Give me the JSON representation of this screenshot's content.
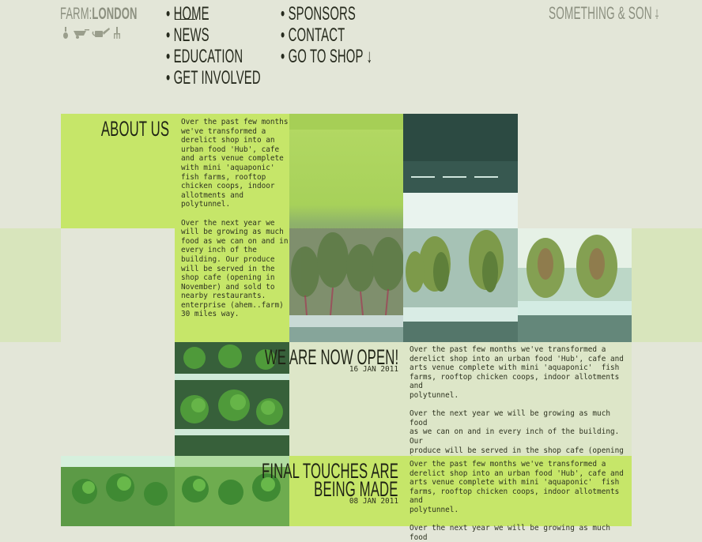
{
  "header": {
    "logo_left": "FARM",
    "logo_sep": ":",
    "logo_right": "LONDON",
    "brand": "SOMETHING & SON",
    "nav": [
      {
        "label": "HOME"
      },
      {
        "label": "NEWS"
      },
      {
        "label": "EDUCATION"
      },
      {
        "label": "GET INVOLVED"
      },
      {
        "label": "SPONSORS"
      },
      {
        "label": "CONTACT"
      },
      {
        "label": "GO TO SHOP"
      }
    ],
    "bullet": "•",
    "shop_arrow": "↓"
  },
  "about": {
    "heading": "ABOUT US",
    "body": "Over the past few months\nwe've transformed a\nderelict shop into an\nurban food 'Hub', cafe\nand arts venue complete\nwith mini 'aquaponic'\nfish farms, rooftop\nchicken coops, indoor\nallotments and\npolytunnel.\n\nOver the next year we\nwill be growing as much\nfood as we can on and in\nevery inch of the\nbuilding. Our produce\nwill be served in the\nshop cafe (opening in\nNovember) and sold to\nnearby restaurants.\nenterprise (ahem..farm)\n30 miles way."
  },
  "posts": [
    {
      "title": "WE ARE NOW OPEN!",
      "date": "16 JAN 2011",
      "body": "Over the past few months we've transformed a\nderelict shop into an urban food 'Hub', cafe and\narts venue complete with mini 'aquaponic'  fish\nfarms, rooftop chicken coops, indoor allotments and\npolytunnel.\n\nOver the next year we will be growing as much food\nas we can on and in every inch of the building. Our\nproduce will be served in the shop cafe (opening in\nNovember) and sold to nearby restaurants."
    },
    {
      "title_line1": "FINAL TOUCHES ARE",
      "title_line2": "BEING MADE",
      "date": "08 JAN 2011",
      "body": "Over the past few months we've transformed a\nderelict shop into an urban food 'Hub', cafe and\narts venue complete with mini 'aquaponic'  fish\nfarms, rooftop chicken coops, indoor allotments and\npolytunnel.\n\nOver the next year we will be growing as much food"
    }
  ],
  "colors": {
    "background": "#e3e6d8",
    "green": "#c6e669",
    "pale": "#d8e5bc",
    "text": "#262a1d",
    "muted": "#8c9080"
  }
}
